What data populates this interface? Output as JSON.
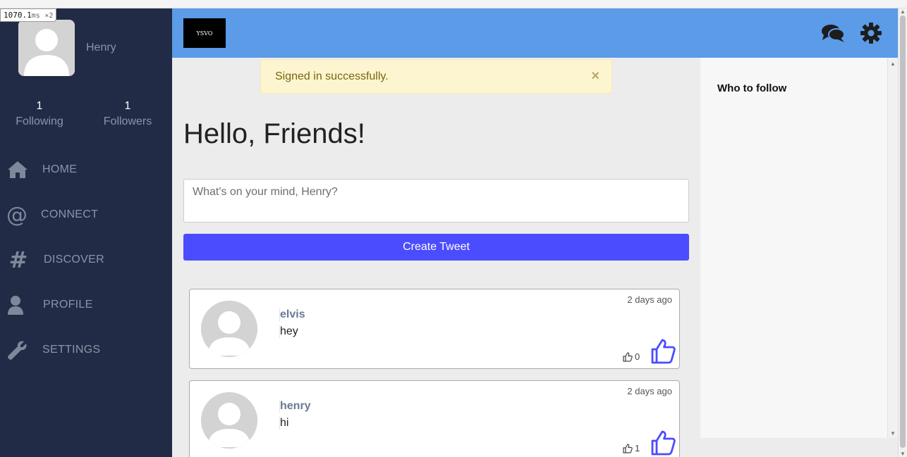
{
  "timing": {
    "value": "1070.1",
    "unit": "ms",
    "multiplier": "×2"
  },
  "profile": {
    "name": "Henry",
    "following_count": "1",
    "following_label": "Following",
    "followers_count": "1",
    "followers_label": "Followers"
  },
  "nav": [
    {
      "label": "HOME",
      "icon": "home-icon"
    },
    {
      "label": "CONNECT",
      "icon": "at-icon"
    },
    {
      "label": "DISCOVER",
      "icon": "hashtag-icon"
    },
    {
      "label": "PROFILE",
      "icon": "user-icon"
    },
    {
      "label": "SETTINGS",
      "icon": "wrench-icon"
    }
  ],
  "header": {
    "logo_text": "YSVO",
    "icons": [
      "chat-icon",
      "gear-icon"
    ]
  },
  "flash": {
    "message": "Signed in successfully.",
    "close": "×"
  },
  "greeting": "Hello, Friends!",
  "composer": {
    "placeholder": "What's on your mind, Henry?",
    "button_label": "Create Tweet"
  },
  "tweets": [
    {
      "author": "elvis",
      "text": "hey",
      "time": "2 days ago",
      "likes": "0"
    },
    {
      "author": "henry",
      "text": "hi",
      "time": "2 days ago",
      "likes": "1"
    }
  ],
  "right_panel": {
    "title": "Who to follow"
  },
  "colors": {
    "sidebar": "#212b45",
    "header": "#5b9be8",
    "button": "#4c4cff",
    "flash_bg": "#fdf5cf",
    "like": "#4c4cff"
  }
}
